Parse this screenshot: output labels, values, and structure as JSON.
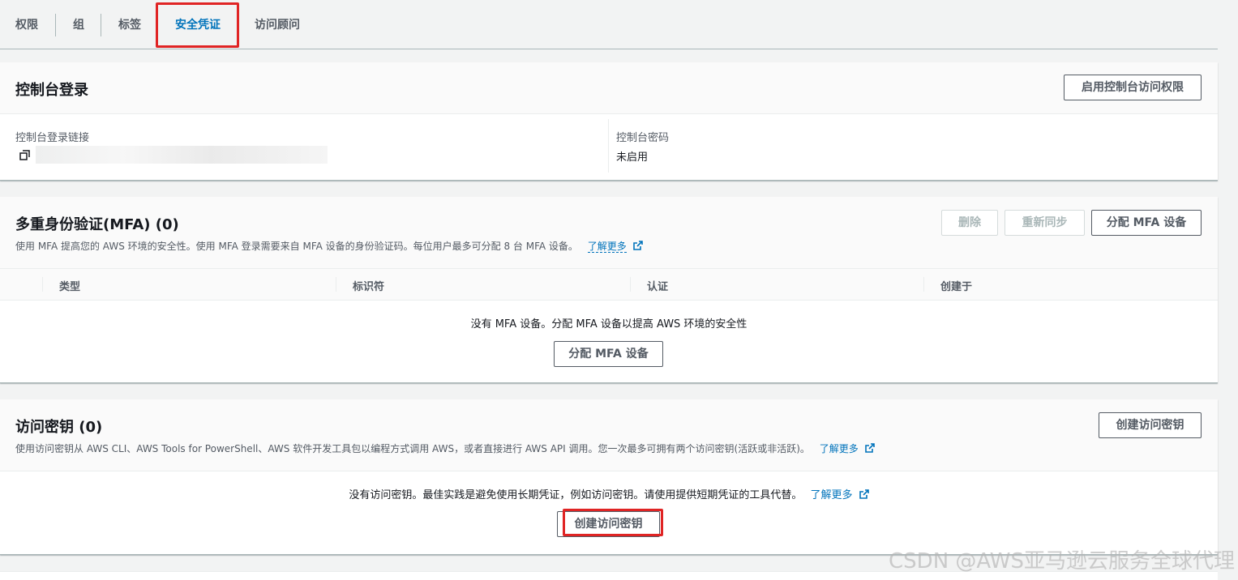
{
  "tabs": [
    "权限",
    "组",
    "标签",
    "安全凭证",
    "访问顾问"
  ],
  "console_signin": {
    "title": "控制台登录",
    "enable_button": "启用控制台访问权限",
    "link_label": "控制台登录链接",
    "password_label": "控制台密码",
    "password_value": "未启用"
  },
  "mfa": {
    "title": "多重身份验证(MFA) (0)",
    "description": "使用 MFA 提高您的 AWS 环境的安全性。使用 MFA 登录需要来自 MFA 设备的身份验证码。每位用户最多可分配 8 台 MFA 设备。",
    "learn_more": "了解更多",
    "delete_button": "删除",
    "resync_button": "重新同步",
    "assign_button": "分配 MFA 设备",
    "columns": [
      "类型",
      "标识符",
      "认证",
      "创建于"
    ],
    "empty_text": "没有 MFA 设备。分配 MFA 设备以提高 AWS 环境的安全性",
    "empty_assign_button": "分配 MFA 设备"
  },
  "access_keys": {
    "title": "访问密钥 (0)",
    "description": "使用访问密钥从 AWS CLI、AWS Tools for PowerShell、AWS 软件开发工具包以编程方式调用 AWS，或者直接进行 AWS API 调用。您一次最多可拥有两个访问密钥(活跃或非活跃)。",
    "learn_more": "了解更多",
    "create_button": "创建访问密钥",
    "empty_text": "没有访问密钥。最佳实践是避免使用长期凭证，例如访问密钥。请使用提供短期凭证的工具代替。",
    "empty_learn_more": "了解更多",
    "empty_create_button": "创建访问密钥"
  },
  "watermark": "CSDN @AWS亚马逊云服务全球代理",
  "colors": {
    "link": "#0073bb",
    "highlight": "#e02424",
    "border": "#aab7b8"
  }
}
